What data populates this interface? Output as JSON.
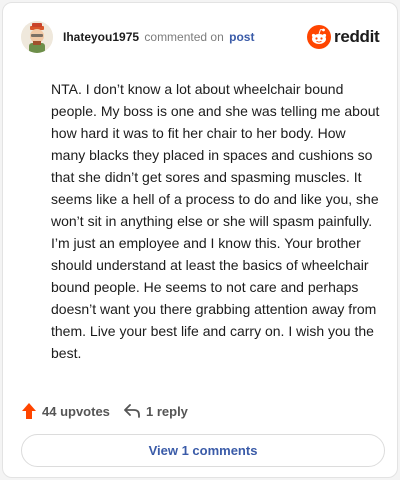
{
  "header": {
    "username": "Ihateyou1975",
    "action_text": "commented on",
    "post_link": "post",
    "brand_name": "reddit",
    "brand_color": "#ff4500"
  },
  "comment": {
    "body": "NTA. I don’t know a lot about wheelchair bound people. My boss is one and she was telling me about how hard it was to fit her chair to her body. How many blacks they placed in spaces and cushions so that she didn’t get sores and spasming muscles. It seems like a hell of a process to do and like you, she won’t sit in anything else or she will spasm painfully. I’m just an employee and I know this. Your brother should understand at least the basics of wheelchair bound people. He seems to not care and perhaps doesn’t want you there grabbing attention away from them. Live your best life and carry on. I wish you the best."
  },
  "actions": {
    "upvotes": "44 upvotes",
    "upvote_color": "#ff4500",
    "reply": "1 reply",
    "view_comments": "View 1 comments"
  }
}
